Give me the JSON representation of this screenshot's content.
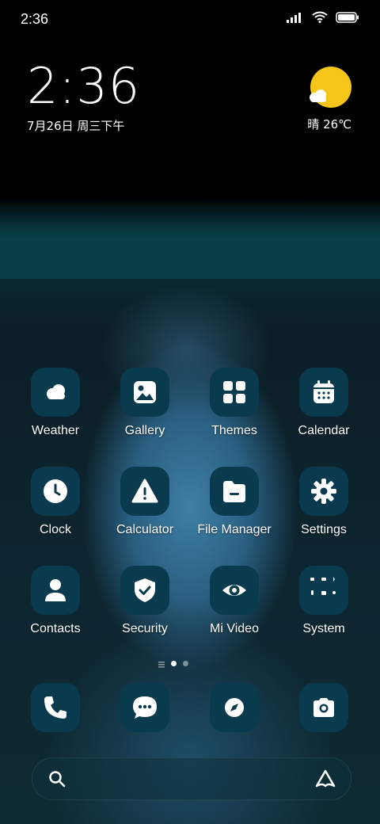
{
  "status_bar": {
    "time": "2:36"
  },
  "clock_widget": {
    "time": "2:36",
    "date": "7月26日 周三下午"
  },
  "weather_widget": {
    "condition": "晴",
    "temperature": "26℃",
    "sun_color": "#f5c518"
  },
  "apps": [
    {
      "label": "Weather",
      "icon": "weather-icon"
    },
    {
      "label": "Gallery",
      "icon": "gallery-icon"
    },
    {
      "label": "Themes",
      "icon": "themes-icon"
    },
    {
      "label": "Calendar",
      "icon": "calendar-icon"
    },
    {
      "label": "Clock",
      "icon": "clock-icon"
    },
    {
      "label": "Calculator",
      "icon": "warning-icon"
    },
    {
      "label": "File Manager",
      "icon": "folder-icon"
    },
    {
      "label": "Settings",
      "icon": "gear-icon"
    },
    {
      "label": "Contacts",
      "icon": "person-icon"
    },
    {
      "label": "Security",
      "icon": "shield-icon"
    },
    {
      "label": "Mi Video",
      "icon": "eye-icon"
    },
    {
      "label": "System",
      "icon": "folder-grid-icon"
    }
  ],
  "pager": {
    "current_page": 1,
    "page_count": 2
  },
  "dock": [
    {
      "icon": "phone-icon"
    },
    {
      "icon": "messages-icon"
    },
    {
      "icon": "browser-icon"
    },
    {
      "icon": "camera-icon"
    }
  ],
  "search": {
    "left_icon": "search-icon",
    "right_icon": "assistant-icon"
  },
  "colors": {
    "icon_bg": "#093a4d",
    "icon_fg": "#ffffff"
  }
}
